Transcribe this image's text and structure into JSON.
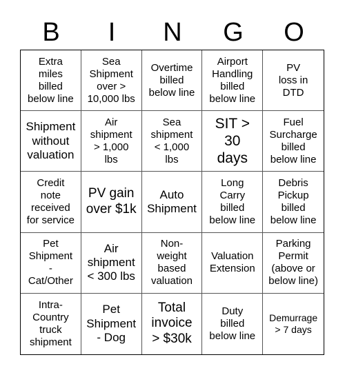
{
  "header": [
    "B",
    "I",
    "N",
    "G",
    "O"
  ],
  "cells": [
    "Extra\nmiles\nbilled\nbelow line",
    "Sea\nShipment\nover >\n10,000 lbs",
    "Overtime\nbilled\nbelow line",
    "Airport\nHandling\nbilled\nbelow line",
    "PV\nloss in\nDTD",
    "Shipment\nwithout\nvaluation",
    "Air\nshipment\n> 1,000\nlbs",
    "Sea\nshipment\n< 1,000\nlbs",
    "SIT >\n30\ndays",
    "Fuel\nSurcharge\nbilled\nbelow line",
    "Credit\nnote\nreceived\nfor service",
    "PV gain\nover $1k",
    "Auto\nShipment",
    "Long\nCarry\nbilled\nbelow line",
    "Debris\nPickup\nbilled\nbelow line",
    "Pet\nShipment\n-\nCat/Other",
    "Air\nshipment\n< 300 lbs",
    "Non-\nweight\nbased\nvaluation",
    "Valuation\nExtension",
    "Parking\nPermit\n(above or\nbelow line)",
    "Intra-\nCountry\ntruck\nshipment",
    "Pet\nShipment\n- Dog",
    "Total\ninvoice\n> $30k",
    "Duty\nbilled\nbelow line",
    "Demurrage\n> 7 days"
  ]
}
